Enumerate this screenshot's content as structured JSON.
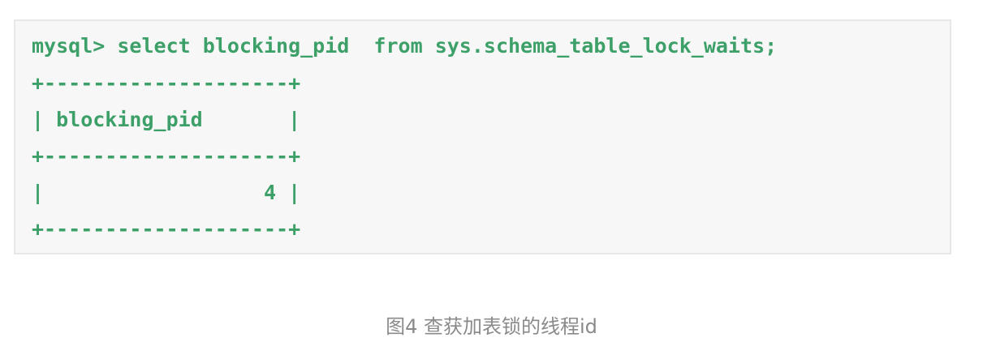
{
  "code_block": {
    "lines": [
      "mysql> select blocking_pid  from sys.schema_table_lock_waits;",
      "+--------------------+",
      "| blocking_pid       |",
      "+--------------------+",
      "|                  4 |",
      "+--------------------+"
    ],
    "text_color": "#3ea069",
    "background_color": "#f7f7f7"
  },
  "caption": "图4 查获加表锁的线程id"
}
